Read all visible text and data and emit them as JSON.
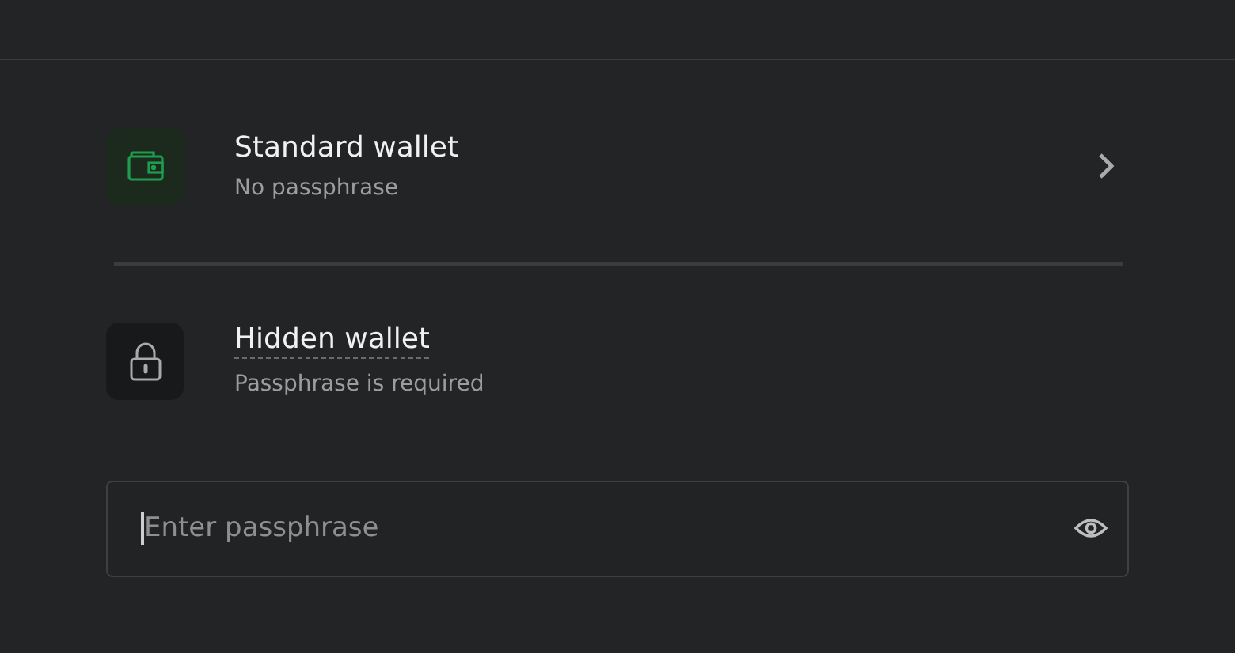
{
  "wallet_options": [
    {
      "kind": "standard",
      "title": "Standard wallet",
      "subtitle": "No passphrase"
    },
    {
      "kind": "hidden",
      "title": "Hidden wallet",
      "subtitle": "Passphrase is required"
    }
  ],
  "passphrase_field": {
    "placeholder": "Enter passphrase",
    "focused": true
  }
}
